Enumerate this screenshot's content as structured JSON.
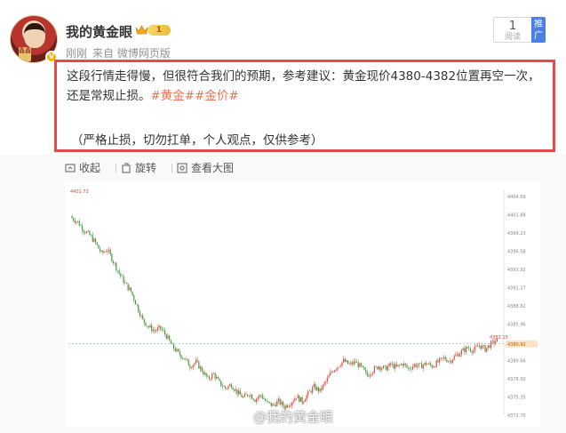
{
  "author": {
    "name": "我的黄金眼",
    "level_badge": "1",
    "vip_mark": "V",
    "avatar_sign": "鑫鑫"
  },
  "meta": {
    "time": "刚刚",
    "source": "来自 微博网页版"
  },
  "read": {
    "count": "1",
    "label": "阅读"
  },
  "promote": {
    "label": "推广"
  },
  "post": {
    "text": "这段行情走得慢，但很符合我们的预期，参考建议：黄金现价4380-4382位置再空一次，还是常规止损。",
    "hashtag1": "#黄金#",
    "hashtag2": "#金价#",
    "note": "（严格止损，切勿扛单，个人观点，仅供参考）"
  },
  "actions": {
    "collapse": "收起",
    "rotate": "旋转",
    "view_large": "查看大图"
  },
  "watermark": "@我的黄金眼",
  "colors": {
    "accent_hashtag": "#eb7350",
    "highlight_border": "#e84a4a",
    "promote_bg": "#4a7fe8",
    "candle_up": "#e0443f",
    "candle_down": "#3a9a3a"
  },
  "chart_data": {
    "type": "candlestick",
    "price_label_top_left": "4401.73",
    "price_label_current": "4382.15",
    "price_label_last": "4380.92",
    "y_ticks": [
      "4404.69",
      "4401.88",
      "4399.23",
      "4396.58",
      "4393.92",
      "4391.27",
      "4388.62",
      "4385.96",
      "4383.31",
      "4380.66",
      "4378.00",
      "4375.35",
      "4372.70"
    ],
    "ylim": [
      4371.5,
      4406
    ],
    "closes": [
      4401.6,
      4401.0,
      4399.8,
      4399.0,
      4397.8,
      4396.2,
      4396.8,
      4395.0,
      4393.2,
      4391.6,
      4390.4,
      4388.2,
      4386.0,
      4385.0,
      4384.4,
      4384.8,
      4383.6,
      4382.0,
      4381.0,
      4380.2,
      4379.0,
      4379.6,
      4378.4,
      4377.0,
      4377.8,
      4376.4,
      4375.6,
      4376.2,
      4375.0,
      4374.2,
      4374.8,
      4373.9,
      4374.6,
      4373.4,
      4373.0,
      4373.6,
      4372.8,
      4373.4,
      4374.4,
      4373.6,
      4374.8,
      4375.8,
      4375.2,
      4376.6,
      4378.2,
      4379.0,
      4379.8,
      4379.2,
      4379.6,
      4378.8,
      4377.6,
      4378.4,
      4379.0,
      4378.6,
      4379.2,
      4378.8,
      4379.4,
      4378.6,
      4379.2,
      4379.0,
      4379.4,
      4379.0,
      4379.6,
      4380.2,
      4379.8,
      4380.6,
      4381.2,
      4381.8,
      4381.4,
      4382.2,
      4381.6,
      4382.4,
      4382.9
    ]
  }
}
